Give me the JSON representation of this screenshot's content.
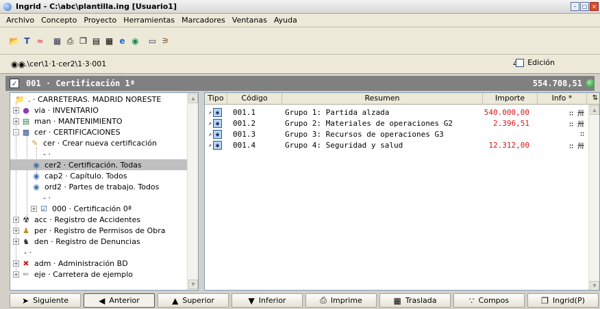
{
  "window": {
    "title": "Ingrid - C:\\abc\\plantilla.ing  [Usuario1]"
  },
  "menu": [
    "Archivo",
    "Concepto",
    "Proyecto",
    "Herramientas",
    "Marcadores",
    "Ventanas",
    "Ayuda"
  ],
  "toolbar": {
    "icons": [
      "open-folder-icon",
      "text-style-icon",
      "rainbow-icon",
      "tree-icon",
      "print-icon",
      "copy-icon",
      "layout-icon",
      "grid-icon",
      "ie-icon",
      "globe-icon",
      "screen-icon",
      "plugin-icon"
    ]
  },
  "pathbar": {
    "path": ".\\cer\\1·1·cer2\\1·3·001",
    "count": "4",
    "edicion_label": "Edición"
  },
  "header": {
    "title": "001 · Certificación 1ª",
    "total": "554.708,51"
  },
  "tree": {
    "items": [
      {
        "label": ". · CARRETERAS. MADRID NORESTE",
        "icon": "folder-icon"
      },
      {
        "label": "via · INVENTARIO",
        "icon": "pin-icon"
      },
      {
        "label": "man · MANTENIMIENTO",
        "icon": "book-icon"
      },
      {
        "label": "cer · CERTIFICACIONES",
        "icon": "case-icon"
      },
      {
        "label": "cer · Crear nueva certificación",
        "icon": "new-doc-icon"
      },
      {
        "label": "- ·",
        "icon": ""
      },
      {
        "label": "cer2 · Certificación. Todas",
        "icon": "view-icon"
      },
      {
        "label": "cap2 · Capítulo. Todos",
        "icon": "view-icon"
      },
      {
        "label": "ord2 · Partes de trabajo. Todos",
        "icon": "view-icon"
      },
      {
        "label": "- ·",
        "icon": ""
      },
      {
        "label": "000 · Certificación 0ª",
        "icon": "check-icon"
      },
      {
        "label": "acc · Registro de Accidentes",
        "icon": "hazard-icon"
      },
      {
        "label": "per · Registro de Permisos de Obra",
        "icon": "people-icon"
      },
      {
        "label": "den · Registro de Denuncias",
        "icon": "crowd-icon"
      },
      {
        "label": "- ·",
        "icon": ""
      },
      {
        "label": "adm · Administración BD",
        "icon": "tools-icon"
      },
      {
        "label": "eje · Carretera de ejemplo",
        "icon": "pencil-icon"
      }
    ]
  },
  "grid": {
    "columns": [
      "Tipo",
      "Código",
      "Resumen",
      "Importe",
      "Info *"
    ],
    "rows": [
      {
        "codigo": "001.1",
        "resumen": "Grupo 1: Partida alzada",
        "importe": "540.000,00",
        "info": "∷ 卅"
      },
      {
        "codigo": "001.2",
        "resumen": "Grupo 2: Materiales de operaciones G2",
        "importe": "2.396,51",
        "info": "∷ 卅"
      },
      {
        "codigo": "001.3",
        "resumen": "Grupo 3: Recursos de operaciones G3",
        "importe": "",
        "info": "∷"
      },
      {
        "codigo": "001.4",
        "resumen": "Grupo 4: Seguridad y salud",
        "importe": "12.312,00",
        "info": "∷ 卅"
      }
    ]
  },
  "bottom_buttons": [
    "Siguiente",
    "Anterior",
    "Superior",
    "Inferior",
    "Imprime",
    "Traslada",
    "Compos",
    "Ingrid(P)"
  ],
  "colors": {
    "importe": "#e01010",
    "header_band": "#808080",
    "selection": "#c0c0c0"
  }
}
